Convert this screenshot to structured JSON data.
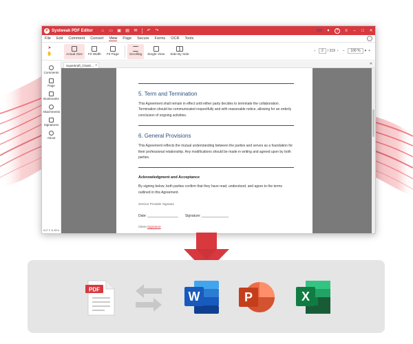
{
  "window": {
    "title": "Systweak PDF Editor",
    "logo_text": "P"
  },
  "menu": [
    "File",
    "Edit",
    "Comment",
    "Convert",
    "View",
    "Page",
    "Secure",
    "Forms",
    "OCR",
    "Tools"
  ],
  "active_menu": "View",
  "toolbar": {
    "tools": [
      {
        "label": "Actual Size",
        "selected": true
      },
      {
        "label": "Fit Width",
        "selected": false
      },
      {
        "label": "Fit Page",
        "selected": false
      },
      {
        "label": "Scrolling",
        "selected": true
      },
      {
        "label": "Single View",
        "selected": false
      },
      {
        "label": "Side By Side",
        "selected": false
      }
    ],
    "page_current": "2",
    "page_total": "/ 219",
    "zoom": "100 %"
  },
  "sidebar": {
    "items": [
      "Comments",
      "Page",
      "Bookmarks",
      "Attachments",
      "Signatures",
      "About"
    ],
    "page_size": "8.27 X 11.69 in"
  },
  "document": {
    "tab_name": "Superkraft_ChatG...",
    "section5_title": "5. Term and Termination",
    "section5_body": "This Agreement shall remain in effect until either party decides to terminate the collaboration. Termination should be communicated respectfully and with reasonable notice, allowing for an orderly conclusion of ongoing activities.",
    "section6_title": "6. General Provisions",
    "section6_body": "This Agreement reflects the mutual understanding between the parties and serves as a foundation for their professional relationship. Any modifications should be made in writing and agreed upon by both parties.",
    "ack_title": "Acknowledgment and Acceptance",
    "ack_body": "By signing below, both parties confirm that they have read, understood, and agree to the terms outlined in this Agreement.",
    "provider_label": "Service Provider Signatur",
    "date_label": "Date: ________________",
    "signature_label": "Signature: ______________",
    "client_label": "Client",
    "client_link": "Signature"
  },
  "conversion": {
    "source_badge": "PDF",
    "targets": [
      {
        "name": "Word",
        "letter": "W",
        "color": "#185abd"
      },
      {
        "name": "PowerPoint",
        "letter": "P",
        "color": "#c43e1c"
      },
      {
        "name": "Excel",
        "letter": "X",
        "color": "#107c41"
      }
    ]
  },
  "colors": {
    "brand_red": "#d7393f",
    "heading_blue": "#2b4f7d",
    "panel_gray": "#e5e5e5"
  }
}
